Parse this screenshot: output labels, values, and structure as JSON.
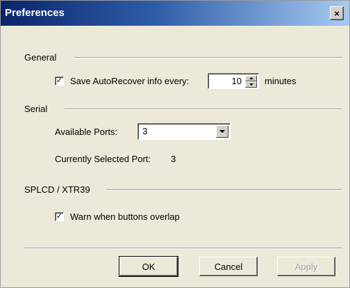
{
  "window": {
    "title": "Preferences",
    "close_label": "×"
  },
  "general": {
    "heading": "General",
    "autorecover_checked": true,
    "autorecover_label": "Save AutoRecover info every:",
    "autorecover_value": "10",
    "autorecover_unit": "minutes"
  },
  "serial": {
    "heading": "Serial",
    "ports_label": "Available Ports:",
    "ports_value": "3",
    "current_label": "Currently Selected Port:",
    "current_value": "3"
  },
  "splcd": {
    "heading": "SPLCD / XTR39",
    "warn_checked": true,
    "warn_label": "Warn when buttons overlap"
  },
  "buttons": {
    "ok": "OK",
    "cancel": "Cancel",
    "apply": "Apply"
  },
  "icons": {
    "check": "✓"
  }
}
